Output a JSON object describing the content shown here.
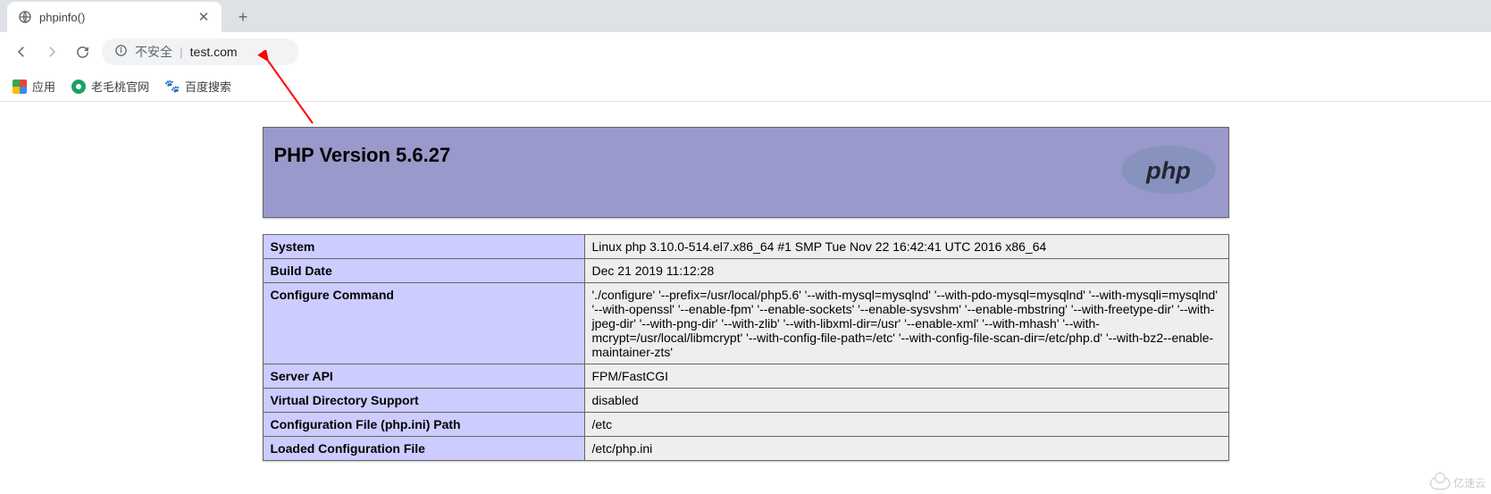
{
  "browser": {
    "tab_title": "phpinfo()",
    "omnibox_security": "不安全",
    "omnibox_url": "test.com",
    "bookmarks_label": "应用",
    "bookmark1": "老毛桃官网",
    "bookmark2": "百度搜索"
  },
  "phpinfo": {
    "header": "PHP Version 5.6.27",
    "rows": [
      {
        "k": "System",
        "v": "Linux php 3.10.0-514.el7.x86_64 #1 SMP Tue Nov 22 16:42:41 UTC 2016 x86_64"
      },
      {
        "k": "Build Date",
        "v": "Dec 21 2019 11:12:28"
      },
      {
        "k": "Configure Command",
        "v": "'./configure' '--prefix=/usr/local/php5.6' '--with-mysql=mysqlnd' '--with-pdo-mysql=mysqlnd' '--with-mysqli=mysqlnd' '--with-openssl' '--enable-fpm' '--enable-sockets' '--enable-sysvshm' '--enable-mbstring' '--with-freetype-dir' '--with-jpeg-dir' '--with-png-dir' '--with-zlib' '--with-libxml-dir=/usr' '--enable-xml' '--with-mhash' '--with-mcrypt=/usr/local/libmcrypt' '--with-config-file-path=/etc' '--with-config-file-scan-dir=/etc/php.d' '--with-bz2--enable-maintainer-zts'"
      },
      {
        "k": "Server API",
        "v": "FPM/FastCGI"
      },
      {
        "k": "Virtual Directory Support",
        "v": "disabled"
      },
      {
        "k": "Configuration File (php.ini) Path",
        "v": "/etc"
      },
      {
        "k": "Loaded Configuration File",
        "v": "/etc/php.ini"
      }
    ]
  },
  "watermark": "亿速云"
}
